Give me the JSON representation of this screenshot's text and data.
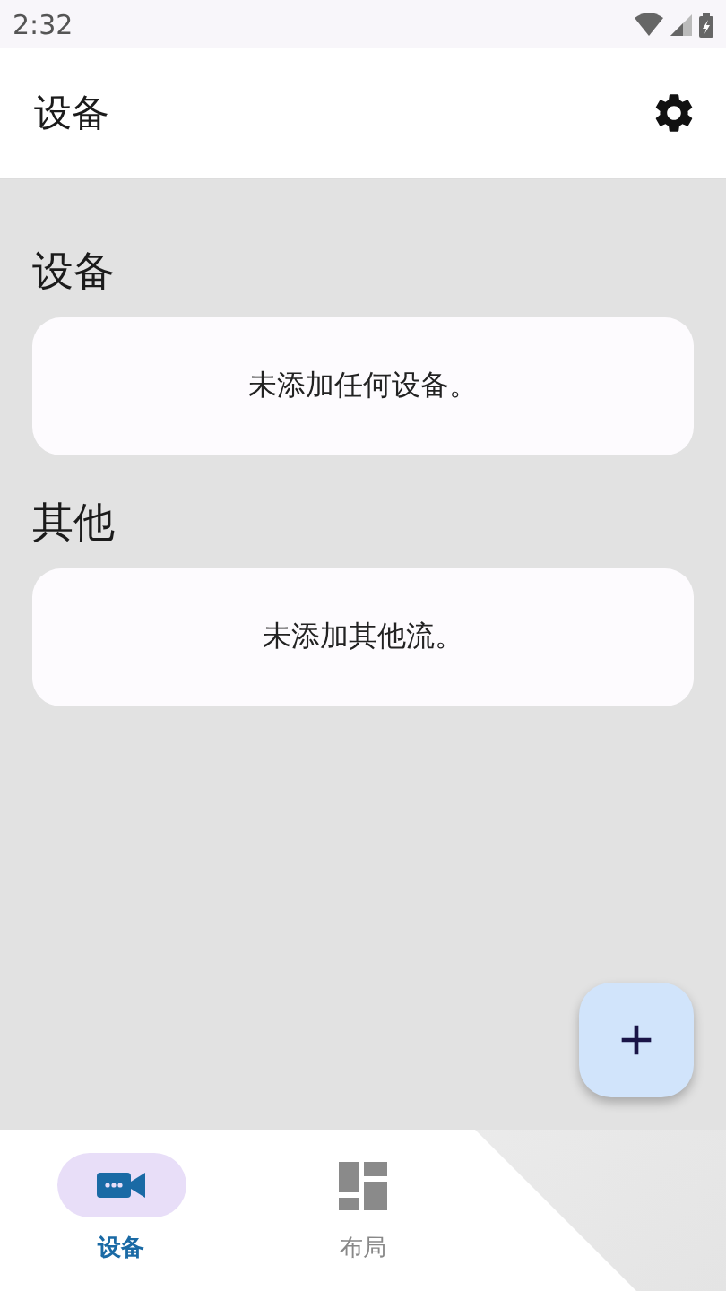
{
  "status_bar": {
    "time": "2:32"
  },
  "app_bar": {
    "title": "设备"
  },
  "sections": [
    {
      "heading": "设备",
      "empty_text": "未添加任何设备。"
    },
    {
      "heading": "其他",
      "empty_text": "未添加其他流。"
    }
  ],
  "nav": [
    {
      "kind": "devices",
      "label": "设备",
      "selected": true
    },
    {
      "kind": "layout",
      "label": "布局",
      "selected": false
    }
  ]
}
